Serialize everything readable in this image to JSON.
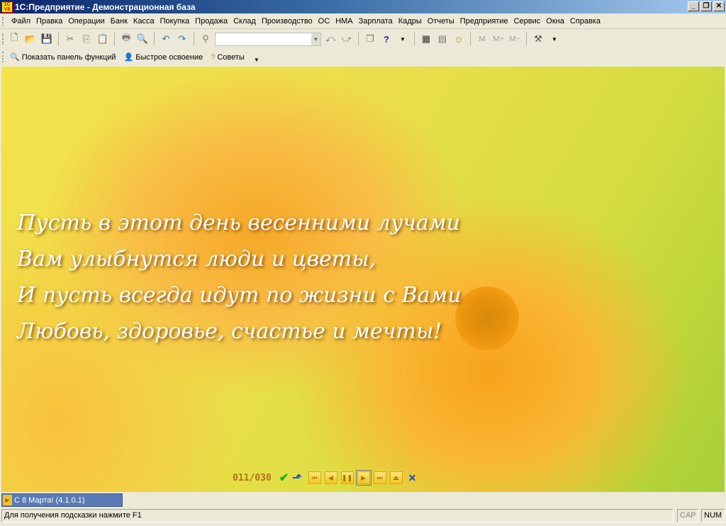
{
  "window": {
    "title": "1C:Предприятие - Демонстрационная база",
    "logo": "1C V8"
  },
  "menu": [
    "Файл",
    "Правка",
    "Операции",
    "Банк",
    "Касса",
    "Покупка",
    "Продажа",
    "Склад",
    "Производство",
    "ОС",
    "НМА",
    "Зарплата",
    "Кадры",
    "Отчеты",
    "Предприятие",
    "Сервис",
    "Окна",
    "Справка"
  ],
  "toolbar2": {
    "show_panel": "Показать панель функций",
    "quick_learn": "Быстрое освоение",
    "tips": "Советы"
  },
  "toolbar": {
    "memory": [
      "M",
      "M+",
      "M−"
    ]
  },
  "poem": [
    "Пусть в этот день весенними лучами",
    "Вам улыбнутся люди и цветы,",
    "И пусть всегда идут по жизни с Вами",
    "Любовь, здоровье, счастье и мечты!"
  ],
  "player": {
    "counter": "011/030"
  },
  "taskbar": {
    "item": "С 8 Марта! (4.1.0.1)"
  },
  "status": {
    "hint": "Для получения подсказки нажмите F1",
    "cap": "CAP",
    "num": "NUM"
  }
}
